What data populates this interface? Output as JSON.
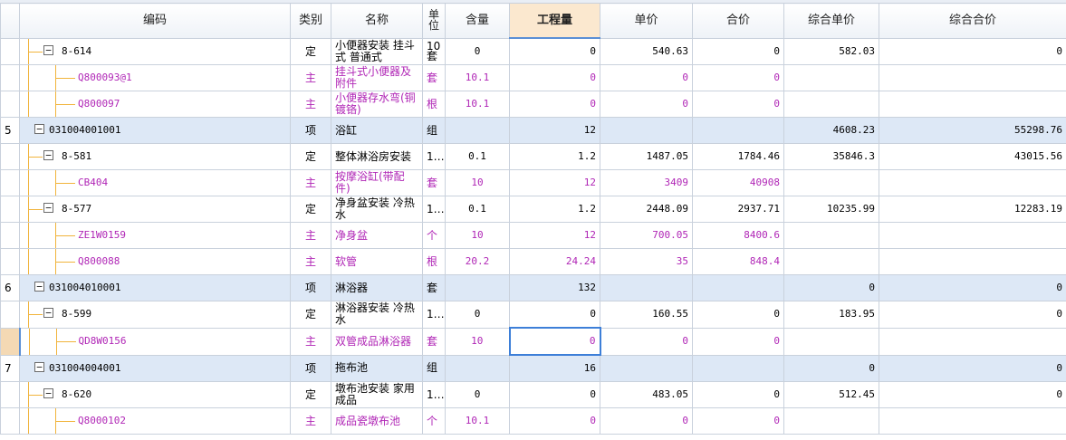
{
  "columns": {
    "code": "编码",
    "category": "类别",
    "name": "名称",
    "unit": "单\n位",
    "content": "含量",
    "quantity": "工程量",
    "unit_price": "单价",
    "total_price": "合价",
    "comp_unit_price": "综合单价",
    "comp_total_price": "综合合价"
  },
  "rows": [
    {
      "idx": "",
      "code": "8-614",
      "level": 1,
      "box": "−",
      "cat": "定",
      "name": "小便器安装 挂斗式 普通式",
      "unit": "10套",
      "content": "0",
      "qty": "0",
      "up": "540.63",
      "tp": "0",
      "cup": "582.03",
      "ctp": "0",
      "kind": "def"
    },
    {
      "idx": "",
      "code": "Q800093@1",
      "level": 2,
      "box": "",
      "cat": "主",
      "name": "挂斗式小便器及附件",
      "unit": "套",
      "content": "10.1",
      "qty": "0",
      "up": "0",
      "tp": "0",
      "cup": "",
      "ctp": "",
      "kind": "main"
    },
    {
      "idx": "",
      "code": "Q800097",
      "level": 2,
      "box": "",
      "cat": "主",
      "name": "小便器存水弯(铜镀铬)",
      "unit": "根",
      "content": "10.1",
      "qty": "0",
      "up": "0",
      "tp": "0",
      "cup": "",
      "ctp": "",
      "kind": "main"
    },
    {
      "idx": "5",
      "code": "031004001001",
      "level": 0,
      "box": "−",
      "cat": "项",
      "name": "浴缸",
      "unit": "组",
      "content": "",
      "qty": "12",
      "up": "",
      "tp": "",
      "cup": "4608.23",
      "ctp": "55298.76",
      "kind": "item"
    },
    {
      "idx": "",
      "code": "8-581",
      "level": 1,
      "box": "−",
      "cat": "定",
      "name": "整体淋浴房安装",
      "unit": "1…",
      "content": "0.1",
      "qty": "1.2",
      "up": "1487.05",
      "tp": "1784.46",
      "cup": "35846.3",
      "ctp": "43015.56",
      "kind": "def"
    },
    {
      "idx": "",
      "code": "CB404",
      "level": 2,
      "box": "",
      "cat": "主",
      "name": "按摩浴缸(带配件)",
      "unit": "套",
      "content": "10",
      "qty": "12",
      "up": "3409",
      "tp": "40908",
      "cup": "",
      "ctp": "",
      "kind": "main"
    },
    {
      "idx": "",
      "code": "8-577",
      "level": 1,
      "box": "−",
      "cat": "定",
      "name": "净身盆安装 冷热水",
      "unit": "1…",
      "content": "0.1",
      "qty": "1.2",
      "up": "2448.09",
      "tp": "2937.71",
      "cup": "10235.99",
      "ctp": "12283.19",
      "kind": "def"
    },
    {
      "idx": "",
      "code": "ZE1W0159",
      "level": 2,
      "box": "",
      "cat": "主",
      "name": "净身盆",
      "unit": "个",
      "content": "10",
      "qty": "12",
      "up": "700.05",
      "tp": "8400.6",
      "cup": "",
      "ctp": "",
      "kind": "main"
    },
    {
      "idx": "",
      "code": "Q800088",
      "level": 2,
      "box": "",
      "cat": "主",
      "name": "软管",
      "unit": "根",
      "content": "20.2",
      "qty": "24.24",
      "up": "35",
      "tp": "848.4",
      "cup": "",
      "ctp": "",
      "kind": "main"
    },
    {
      "idx": "6",
      "code": "031004010001",
      "level": 0,
      "box": "−",
      "cat": "项",
      "name": "淋浴器",
      "unit": "套",
      "content": "",
      "qty": "132",
      "up": "",
      "tp": "",
      "cup": "0",
      "ctp": "0",
      "kind": "item"
    },
    {
      "idx": "",
      "code": "8-599",
      "level": 1,
      "box": "−",
      "cat": "定",
      "name": "淋浴器安装 冷热水",
      "unit": "1…",
      "content": "0",
      "qty": "0",
      "up": "160.55",
      "tp": "0",
      "cup": "183.95",
      "ctp": "0",
      "kind": "def"
    },
    {
      "idx": "",
      "code": "QD8W0156",
      "level": 2,
      "box": "",
      "cat": "主",
      "name": "双管成品淋浴器",
      "unit": "套",
      "content": "10",
      "qty": "0",
      "up": "0",
      "tp": "0",
      "cup": "",
      "ctp": "",
      "kind": "main",
      "current": true
    },
    {
      "idx": "7",
      "code": "031004004001",
      "level": 0,
      "box": "−",
      "cat": "项",
      "name": "拖布池",
      "unit": "组",
      "content": "",
      "qty": "16",
      "up": "",
      "tp": "",
      "cup": "0",
      "ctp": "0",
      "kind": "item"
    },
    {
      "idx": "",
      "code": "8-620",
      "level": 1,
      "box": "−",
      "cat": "定",
      "name": "墩布池安装 家用成品",
      "unit": "1…",
      "content": "0",
      "qty": "0",
      "up": "483.05",
      "tp": "0",
      "cup": "512.45",
      "ctp": "0",
      "kind": "def"
    },
    {
      "idx": "",
      "code": "Q8000102",
      "level": 2,
      "box": "",
      "cat": "主",
      "name": "成品瓷墩布池",
      "unit": "个",
      "content": "10.1",
      "qty": "0",
      "up": "0",
      "tp": "0",
      "cup": "",
      "ctp": "",
      "kind": "main"
    }
  ]
}
